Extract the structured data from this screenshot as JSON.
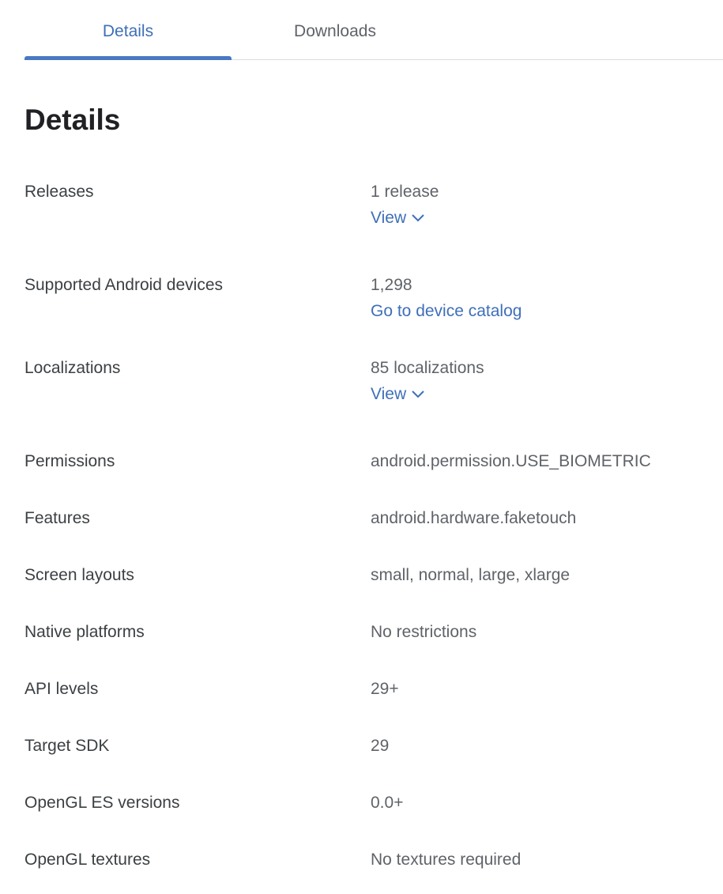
{
  "tabs": [
    {
      "label": "Details",
      "active": true
    },
    {
      "label": "Downloads",
      "active": false
    }
  ],
  "section_title": "Details",
  "rows": [
    {
      "label": "Releases",
      "value": "1 release",
      "link": "View",
      "link_icon": "chevron-down-icon"
    },
    {
      "label": "Supported Android devices",
      "value": "1,298",
      "link": "Go to device catalog"
    },
    {
      "label": "Localizations",
      "value": "85 localizations",
      "link": "View",
      "link_icon": "chevron-down-icon"
    },
    {
      "label": "Permissions",
      "value": "android.permission.USE_BIOMETRIC"
    },
    {
      "label": "Features",
      "value": "android.hardware.faketouch"
    },
    {
      "label": "Screen layouts",
      "value": "small, normal, large, xlarge"
    },
    {
      "label": "Native platforms",
      "value": "No restrictions"
    },
    {
      "label": "API levels",
      "value": "29+"
    },
    {
      "label": "Target SDK",
      "value": "29"
    },
    {
      "label": "OpenGL ES versions",
      "value": "0.0+"
    },
    {
      "label": "OpenGL textures",
      "value": "No textures required"
    }
  ],
  "colors": {
    "accent": "#3f6fb8",
    "label_text": "#3c4043",
    "value_text": "#5f6368",
    "divider": "#dadce0"
  }
}
